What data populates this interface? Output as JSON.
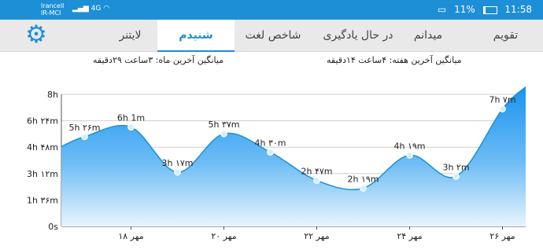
{
  "status_bar": {
    "carrier_line1": "Irancell",
    "carrier_line2": "IR-MCI",
    "network": "4G",
    "battery": "11%",
    "time": "11:58"
  },
  "tabs": [
    {
      "label": "تقویم"
    },
    {
      "label": "میدانم"
    },
    {
      "label": "در حال یادگیری"
    },
    {
      "label": "شاخص لغت"
    },
    {
      "label": "شنیدم",
      "active": true
    },
    {
      "label": "لایتنر"
    }
  ],
  "stats": {
    "week_avg": "میانگین آخرین هفته: ۴ساعت ۱۴دقیقه",
    "month_avg": "میانگین آخرین ماه: ۳ساعت ۲۹دقیقه"
  },
  "colors": {
    "accent": "#1d8fd6",
    "area_top": "#1a94ef",
    "area_bottom": "#e3f2fd"
  },
  "chart_data": {
    "type": "area",
    "title": "",
    "xlabel": "",
    "ylabel": "",
    "ylim": [
      0,
      480
    ],
    "y_ticks": [
      {
        "value": 0,
        "label": "0s"
      },
      {
        "value": 96,
        "label": "1h ۳۶m"
      },
      {
        "value": 192,
        "label": "3h ۱۲m"
      },
      {
        "value": 288,
        "label": "4h ۴۸m"
      },
      {
        "value": 384,
        "label": "6h ۲۴m"
      },
      {
        "value": 480,
        "label": "8h"
      }
    ],
    "x_ticks": [
      {
        "day": 18,
        "label": "۱۸ مهر"
      },
      {
        "day": 20,
        "label": "۲۰ مهر"
      },
      {
        "day": 22,
        "label": "۲۲ مهر"
      },
      {
        "day": 24,
        "label": "۲۴ مهر"
      },
      {
        "day": 26,
        "label": "۲۶ مهر"
      }
    ],
    "x_range": [
      16.5,
      26.5
    ],
    "start_value": 290,
    "points": [
      {
        "day": 17,
        "value": 326,
        "label": "5h ۲۶m"
      },
      {
        "day": 18,
        "value": 361,
        "label": "6h 1m"
      },
      {
        "day": 19,
        "value": 197,
        "label": "3h ۱۷m"
      },
      {
        "day": 20,
        "value": 337,
        "label": "5h ۳۷m"
      },
      {
        "day": 21,
        "value": 270,
        "label": "4h ۳۰m"
      },
      {
        "day": 22,
        "value": 167,
        "label": "2h ۴۷m"
      },
      {
        "day": 23,
        "value": 139,
        "label": "2h ۱۹m"
      },
      {
        "day": 24,
        "value": 259,
        "label": "4h ۱۹m"
      },
      {
        "day": 25,
        "value": 182,
        "label": "3h ۲m"
      },
      {
        "day": 26,
        "value": 427,
        "label": "7h ۷m"
      }
    ],
    "grid": true
  }
}
